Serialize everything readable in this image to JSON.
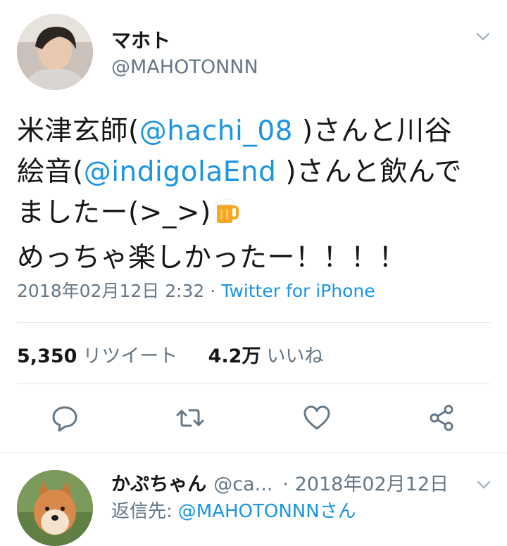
{
  "tweet": {
    "display_name": "マホト",
    "handle": "@MAHOTONNN",
    "text": {
      "line1_a": "米津玄師(",
      "mention1": "@hachi_08",
      "line1_b": " )さんと川谷",
      "line2_a": "絵音(",
      "mention2": "@indigolaEnd",
      "line2_b": " )さんと飲んで",
      "line3": "ましたー(>_>)",
      "line4": "めっちゃ楽しかったー！！！！"
    },
    "timestamp": "2018年02月12日 2:32",
    "separator": "·",
    "source": "Twitter for iPhone",
    "retweets_count": "5,350",
    "retweets_label": "リツイート",
    "likes_count": "4.2万",
    "likes_label": "いいね"
  },
  "icons": {
    "chevron": "chevron-down-icon",
    "beer": "beer-mug-icon",
    "reply": "reply-icon",
    "retweet": "retweet-icon",
    "like": "heart-icon",
    "share": "share-icon"
  },
  "reply": {
    "display_name": "かぷちゃん",
    "handle": "@ca...",
    "date": "· 2018年02月12日",
    "reply_to_label": "返信先:",
    "reply_to_mention": "@MAHOTONNNさん"
  },
  "colors": {
    "link": "#1b95e0",
    "muted": "#657786",
    "text": "#14171a",
    "divider": "#e1e8ed"
  }
}
